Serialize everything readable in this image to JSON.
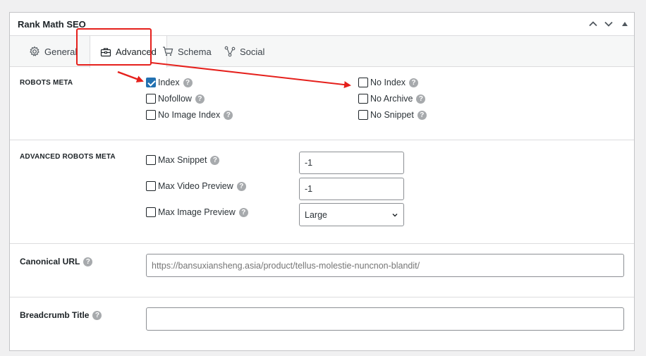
{
  "panel": {
    "title": "Rank Math SEO"
  },
  "header_buttons": [
    {
      "name": "move-up",
      "icon": "chevron-up-icon"
    },
    {
      "name": "move-down",
      "icon": "chevron-down-icon"
    },
    {
      "name": "toggle-panel",
      "icon": "triangle-up-icon"
    }
  ],
  "tabs": [
    {
      "label": "General",
      "icon": "gear-icon",
      "active": false
    },
    {
      "label": "Advanced",
      "icon": "toolbox-icon",
      "active": true
    },
    {
      "label": "Schema",
      "icon": "cart-icon",
      "active": false
    },
    {
      "label": "Social",
      "icon": "share-icon",
      "active": false
    }
  ],
  "robots_meta": {
    "label": "ROBOTS META",
    "left": [
      {
        "label": "Index",
        "checked": true
      },
      {
        "label": "Nofollow",
        "checked": false
      },
      {
        "label": "No Image Index",
        "checked": false
      }
    ],
    "right": [
      {
        "label": "No Index",
        "checked": false
      },
      {
        "label": "No Archive",
        "checked": false
      },
      {
        "label": "No Snippet",
        "checked": false
      }
    ]
  },
  "advanced_robots": {
    "label": "ADVANCED ROBOTS META",
    "rows": [
      {
        "label": "Max Snippet",
        "checked": false,
        "value": "-1"
      },
      {
        "label": "Max Video Preview",
        "checked": false,
        "value": "-1"
      },
      {
        "label": "Max Image Preview",
        "checked": false,
        "value": "Large"
      }
    ]
  },
  "canonical": {
    "label": "Canonical URL",
    "placeholder": "https://bansuxiansheng.asia/product/tellus-molestie-nuncnon-blandit/"
  },
  "breadcrumb": {
    "label": "Breadcrumb Title",
    "value": ""
  },
  "help_glyph": "?",
  "annotation_color": "#e5201c",
  "accent_color": "#2271b1"
}
